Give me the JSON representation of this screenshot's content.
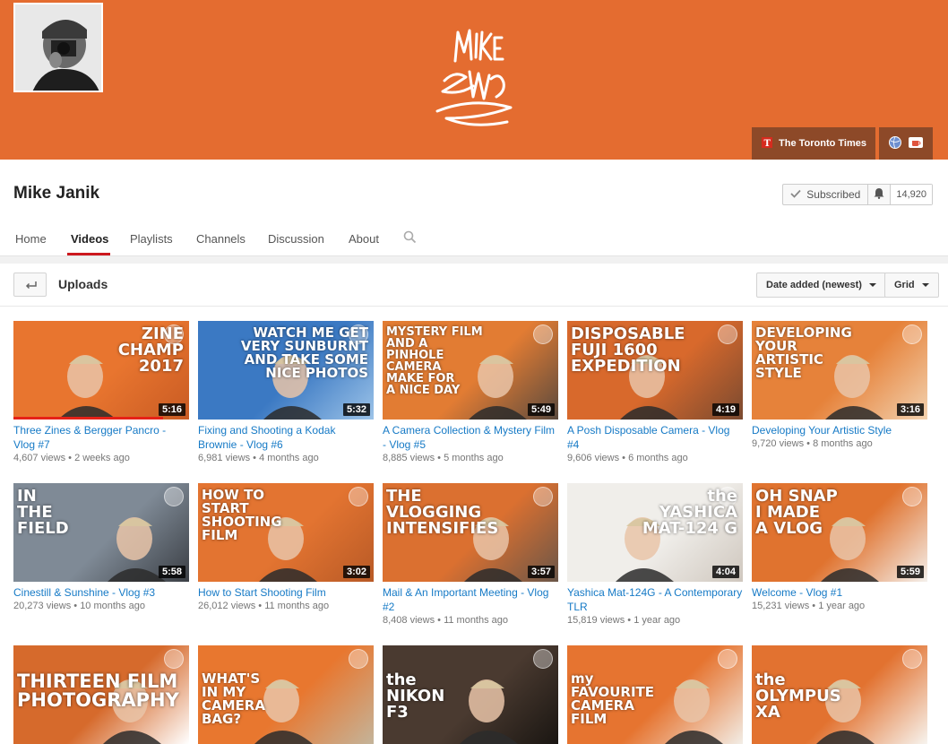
{
  "colors": {
    "banner": "#e46c30",
    "link": "#167ac6",
    "accent": "#cc181e"
  },
  "banner": {
    "logo_text": "Mike Janik",
    "links": [
      {
        "label": "The Toronto Times",
        "icon": "newspaper-icon"
      },
      {
        "label": "",
        "icon": "globe-icon"
      },
      {
        "label": "",
        "icon": "coffee-icon"
      }
    ]
  },
  "channel": {
    "title": "Mike Janik",
    "subscribe_label": "Subscribed",
    "subscriber_count": "14,920"
  },
  "tabs": [
    {
      "label": "Home"
    },
    {
      "label": "Videos",
      "active": true
    },
    {
      "label": "Playlists"
    },
    {
      "label": "Channels"
    },
    {
      "label": "Discussion"
    },
    {
      "label": "About"
    }
  ],
  "uploads": {
    "title": "Uploads",
    "sort_label": "Date added (newest)",
    "view_label": "Grid"
  },
  "videos": [
    {
      "overlay": [
        "ZINE",
        "CHAMP",
        "2017"
      ],
      "duration": "5:16",
      "title": "Three Zines & Bergger Pancro - Vlog #7",
      "views": "4,607 views",
      "age": "2 weeks ago",
      "watched": 0.85
    },
    {
      "overlay": [
        "WATCH ME GET",
        "VERY SUNBURNT",
        "AND TAKE SOME",
        "NICE PHOTOS"
      ],
      "duration": "5:32",
      "title": "Fixing and Shooting a Kodak Brownie - Vlog #6",
      "views": "6,981 views",
      "age": "4 months ago"
    },
    {
      "overlay": [
        "MYSTERY FILM",
        "AND A",
        "PINHOLE",
        "CAMERA",
        "MAKE FOR",
        "A NICE DAY"
      ],
      "duration": "5:49",
      "title": "A Camera Collection & Mystery Film - Vlog #5",
      "views": "8,885 views",
      "age": "5 months ago"
    },
    {
      "overlay": [
        "DISPOSABLE",
        "FUJI 1600",
        "EXPEDITION"
      ],
      "duration": "4:19",
      "title": "A Posh Disposable Camera - Vlog #4",
      "views": "9,606 views",
      "age": "6 months ago"
    },
    {
      "overlay": [
        "DEVELOPING",
        "YOUR",
        "ARTISTIC",
        "STYLE"
      ],
      "duration": "3:16",
      "title": "Developing Your Artistic Style",
      "views": "9,720 views",
      "age": "8 months ago"
    },
    {
      "overlay": [
        "IN",
        "THE",
        "FIELD"
      ],
      "duration": "5:58",
      "title": "Cinestill & Sunshine - Vlog #3",
      "views": "20,273 views",
      "age": "10 months ago"
    },
    {
      "overlay": [
        "HOW TO",
        "START",
        "SHOOTING",
        "FILM"
      ],
      "duration": "3:02",
      "title": "How to Start Shooting Film",
      "views": "26,012 views",
      "age": "11 months ago"
    },
    {
      "overlay": [
        "THE",
        "VLOGGING",
        "INTENSIFIES"
      ],
      "duration": "3:57",
      "title": "Mail & An Important Meeting - Vlog #2",
      "views": "8,408 views",
      "age": "11 months ago"
    },
    {
      "overlay": [
        "the",
        "YASHICA",
        "MAT-124 G"
      ],
      "duration": "4:04",
      "title": "Yashica Mat-124G - A Contemporary TLR",
      "views": "15,819 views",
      "age": "1 year ago"
    },
    {
      "overlay": [
        "OH SNAP",
        "I MADE",
        "A VLOG"
      ],
      "duration": "5:59",
      "title": "Welcome - Vlog #1",
      "views": "15,231 views",
      "age": "1 year ago"
    },
    {
      "overlay": [
        "THIRTEEN FILM",
        "PHOTOGRAPHY"
      ],
      "duration": "",
      "title": "",
      "views": "",
      "age": ""
    },
    {
      "overlay": [
        "WHAT'S",
        "IN MY",
        "CAMERA",
        "BAG?"
      ],
      "duration": "",
      "title": "",
      "views": "",
      "age": ""
    },
    {
      "overlay": [
        "the",
        "NIKON",
        "F3"
      ],
      "duration": "",
      "title": "",
      "views": "",
      "age": ""
    },
    {
      "overlay": [
        "my",
        "FAVOURITE",
        "CAMERA",
        "FILM"
      ],
      "duration": "",
      "title": "",
      "views": "",
      "age": ""
    },
    {
      "overlay": [
        "the",
        "OLYMPUS",
        "XA"
      ],
      "duration": "",
      "title": "",
      "views": "",
      "age": ""
    }
  ]
}
